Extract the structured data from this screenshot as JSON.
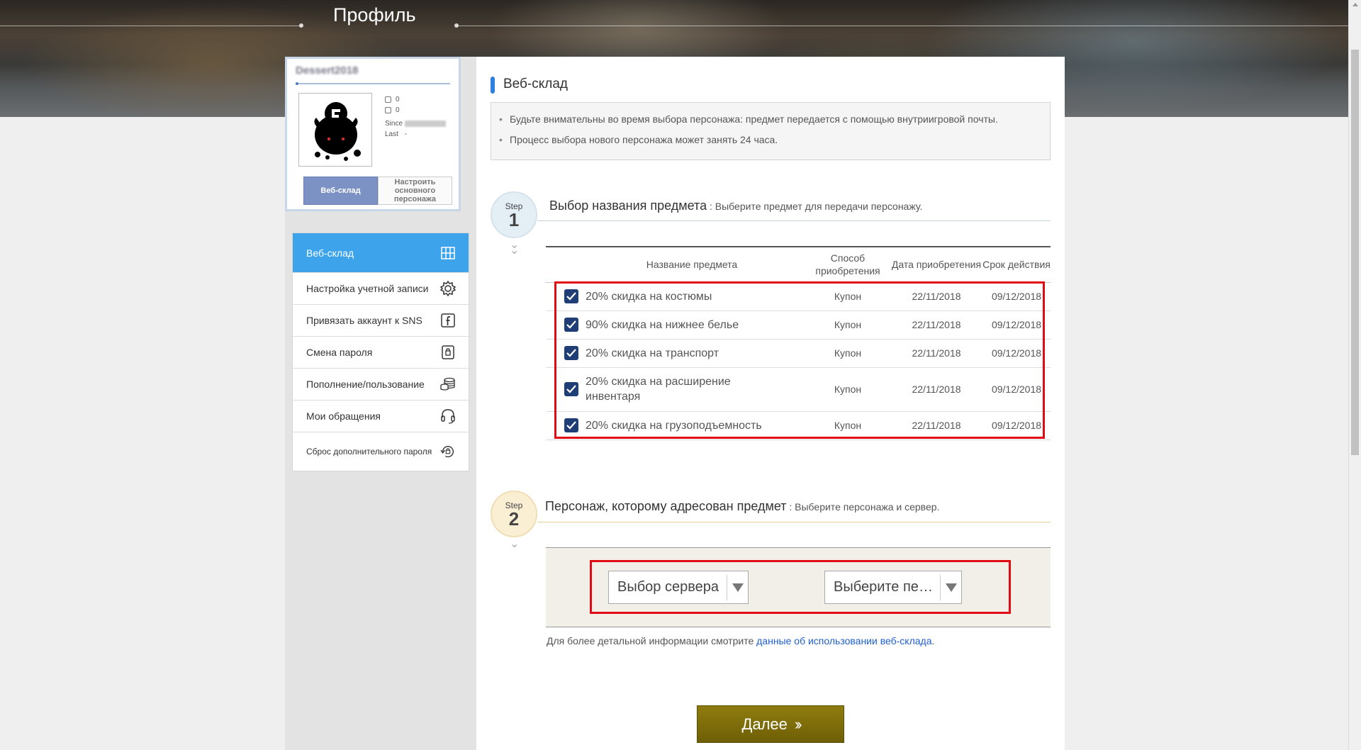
{
  "header": {
    "title": "Профиль"
  },
  "profile": {
    "username": "Dessert2018",
    "stats": [
      {
        "icon": "document-icon",
        "value": "0"
      },
      {
        "icon": "cash-icon",
        "value": "0"
      }
    ],
    "since_label": "Since",
    "last_label": "Last",
    "last_value": "-",
    "websklad_button": "Веб-склад",
    "main_char_button": "Настроить основного персонажа"
  },
  "menu": {
    "items": [
      {
        "label": "Веб-склад",
        "icon": "storage-icon"
      },
      {
        "label": "Настройка учетной записи",
        "icon": "gear-icon"
      },
      {
        "label": "Привязать аккаунт к SNS",
        "icon": "facebook-icon"
      },
      {
        "label": "Смена пароля",
        "icon": "lock-icon"
      },
      {
        "label": "Пополнение/пользование",
        "icon": "coins-icon"
      },
      {
        "label": "Мои обращения",
        "icon": "headset-icon"
      },
      {
        "label": "Сброс дополнительного пароля",
        "icon": "reset-icon"
      }
    ]
  },
  "main": {
    "section_title": "Веб-склад",
    "notices": [
      "Будьте внимательны во время выбора персонажа: предмет передается с помощью внутриигровой почты.",
      "Процесс выбора нового персонажа может занять 24 часа."
    ],
    "step1": {
      "label": "Step",
      "number": "1",
      "title": "Выбор названия предмета",
      "subtitle": " : Выберите предмет для передачи персонажу."
    },
    "table": {
      "headers": [
        "Название предмета",
        "Способ приобретения",
        "Дата приобретения",
        "Срок действия"
      ],
      "rows": [
        {
          "name": "20% скидка на костюмы",
          "method": "Купон",
          "date": "22/11/2018",
          "expiry": "09/12/2018",
          "checked": true
        },
        {
          "name": "90% скидка на нижнее белье",
          "method": "Купон",
          "date": "22/11/2018",
          "expiry": "09/12/2018",
          "checked": true
        },
        {
          "name": "20% скидка на транспорт",
          "method": "Купон",
          "date": "22/11/2018",
          "expiry": "09/12/2018",
          "checked": true
        },
        {
          "name": "20% скидка на расширение инвентаря",
          "method": "Купон",
          "date": "22/11/2018",
          "expiry": "09/12/2018",
          "checked": true
        },
        {
          "name": "20% скидка на грузоподъемность",
          "method": "Купон",
          "date": "22/11/2018",
          "expiry": "09/12/2018",
          "checked": true
        }
      ]
    },
    "step2": {
      "label": "Step",
      "number": "2",
      "title": "Персонаж, которому адресован предмет",
      "subtitle": " : Выберите персонажа и сервер."
    },
    "server_select": "Выбор сервера",
    "char_select": "Выберите персонажа",
    "info_text": "Для более детальной информации смотрите ",
    "info_link": "данные об использовании веб-склада",
    "info_end": ".",
    "next_button": "Далее"
  },
  "colors": {
    "accent_blue": "#3da4ec",
    "button_olive": "#7d6c0a",
    "highlight_red": "#e00b14",
    "checkbox_navy": "#1f3e75"
  }
}
